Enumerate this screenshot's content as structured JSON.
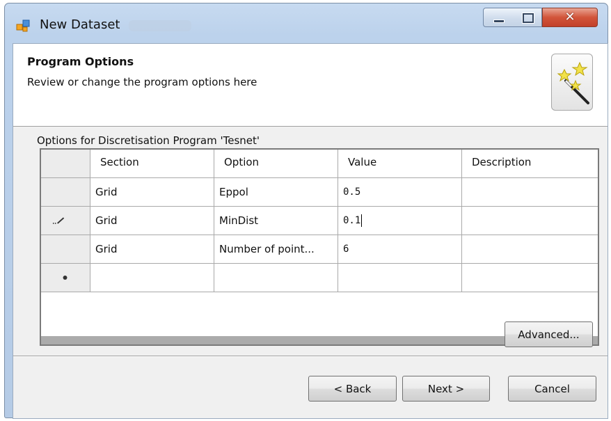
{
  "window": {
    "title": "New Dataset",
    "controls": {
      "minimize": "minimize",
      "maximize": "maximize",
      "close": "✕"
    }
  },
  "header": {
    "title": "Program Options",
    "subtitle": "Review or change the program options here",
    "icon": "wizard-wand-icon"
  },
  "options": {
    "group_label": "Options for Discretisation Program 'Tesnet'",
    "columns": [
      "Section",
      "Option",
      "Value",
      "Description"
    ],
    "rows": [
      {
        "section": "Grid",
        "option": "Eppol",
        "value": "0.5",
        "description": "",
        "marker": ""
      },
      {
        "section": "Grid",
        "option": "MinDist",
        "value": "0.1",
        "description": "",
        "marker": "pencil-icon"
      },
      {
        "section": "Grid",
        "option": "Number of point...",
        "value": "6",
        "description": "",
        "marker": ""
      },
      {
        "section": "",
        "option": "",
        "value": "",
        "description": "",
        "marker": "new-row-icon"
      }
    ]
  },
  "buttons": {
    "advanced": "Advanced...",
    "back": "< Back",
    "next": "Next >",
    "cancel": "Cancel"
  },
  "colors": {
    "frame": "#bcd2ec",
    "close_button": "#d2553a",
    "dialog_background": "#f0f0f0",
    "grid_footer": "#ababab"
  }
}
